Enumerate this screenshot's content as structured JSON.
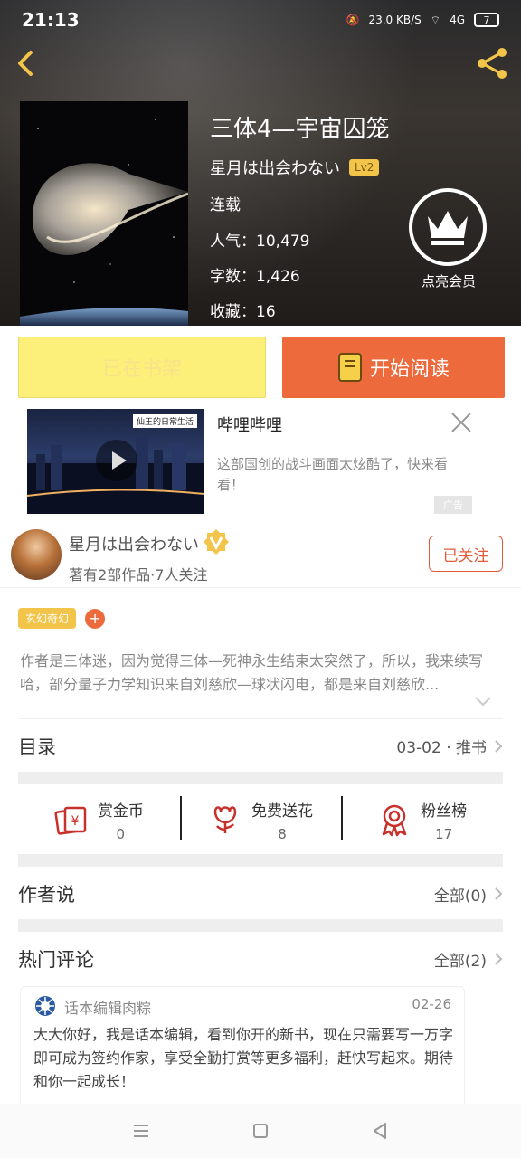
{
  "status_bar": {
    "time": "21:13",
    "speed": "23.0",
    "speed_unit": "KB/S",
    "network": "4G",
    "battery": "7"
  },
  "book": {
    "title": "三体4—宇宙囚笼",
    "author": "星月は出会わない",
    "level": "Lv2",
    "status": "连载",
    "popularity_label": "人气：",
    "popularity": "10,479",
    "words_label": "字数：",
    "words": "1,426",
    "favorites_label": "收藏：",
    "favorites": "16"
  },
  "vip": {
    "label": "点亮会员"
  },
  "actions": {
    "shelf_label": "已在书架",
    "read_label": "开始阅读"
  },
  "ad": {
    "thumb_tag": "仙王的日常生活",
    "title": "哔哩哔哩",
    "description": "这部国创的战斗画面太炫酷了，快来看看！",
    "label": "广告"
  },
  "author_info": {
    "name": "星月は出会わない",
    "subtitle": "著有2部作品·7人关注",
    "follow_label": "已关注"
  },
  "tags": {
    "genre": "玄幻奇幻",
    "add": "+"
  },
  "intro": "作者是三体迷，因为觉得三体—死神永生结束太突然了，所以，我来续写哈，部分量子力学知识来自刘慈欣—球状闪电，都是来自刘慈欣...",
  "catalog": {
    "title": "目录",
    "right": "03-02 · 推书"
  },
  "stats": [
    {
      "label": "赏金币",
      "value": "0",
      "icon": "coin-envelope-icon"
    },
    {
      "label": "免费送花",
      "value": "8",
      "icon": "flower-icon"
    },
    {
      "label": "粉丝榜",
      "value": "17",
      "icon": "medal-icon"
    }
  ],
  "author_says": {
    "title": "作者说",
    "right": "全部(0)"
  },
  "hot_comments": {
    "title": "热门评论",
    "right": "全部(2)"
  },
  "comment": {
    "user": "话本编辑肉粽",
    "date": "02-26",
    "text": "大大你好，我是话本编辑，看到你开的新书，现在只需要写一万字即可成为签约作家，享受全勤打赏等更多福利，赶快写起来。期待和你一起成长！"
  },
  "colors": {
    "accent_orange": "#ec6a3c",
    "accent_yellow": "#f3c44a",
    "shelf_yellow": "#fdf07a"
  }
}
